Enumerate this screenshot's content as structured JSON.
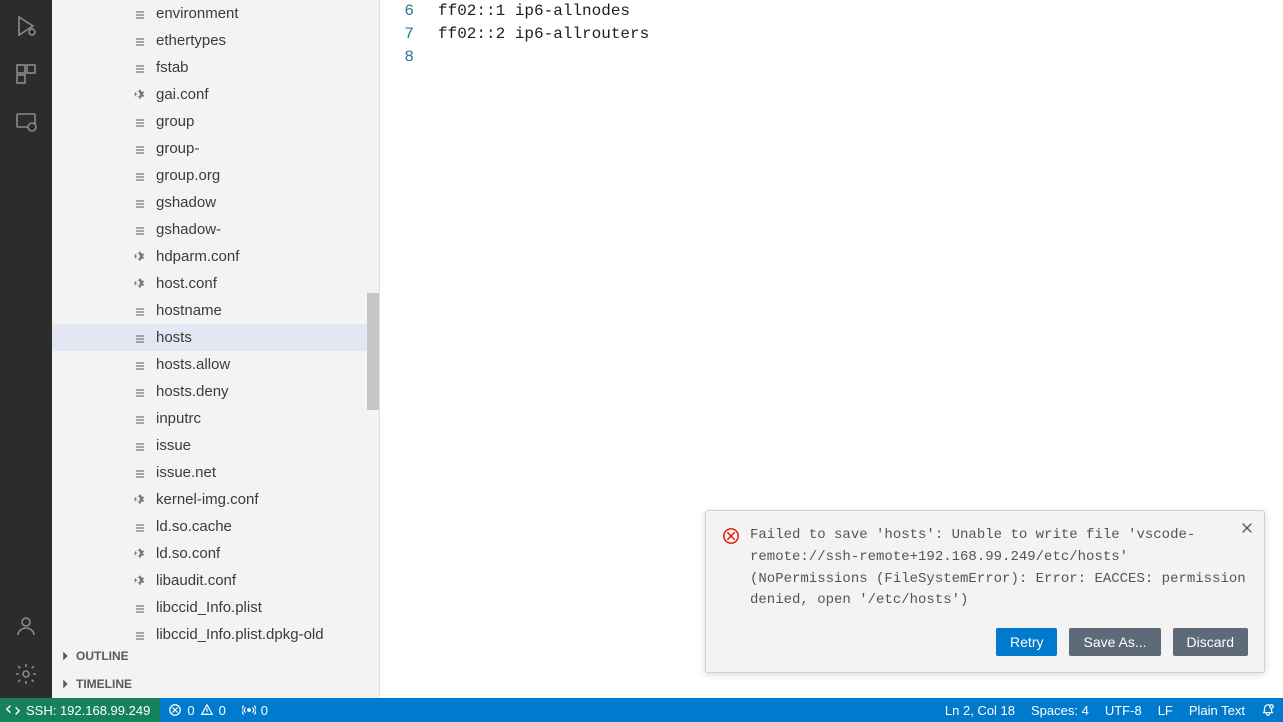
{
  "sidebar": {
    "files": [
      {
        "name": "environment",
        "icon": "file"
      },
      {
        "name": "ethertypes",
        "icon": "file"
      },
      {
        "name": "fstab",
        "icon": "file"
      },
      {
        "name": "gai.conf",
        "icon": "gear"
      },
      {
        "name": "group",
        "icon": "file"
      },
      {
        "name": "group-",
        "icon": "file"
      },
      {
        "name": "group.org",
        "icon": "file"
      },
      {
        "name": "gshadow",
        "icon": "file"
      },
      {
        "name": "gshadow-",
        "icon": "file"
      },
      {
        "name": "hdparm.conf",
        "icon": "gear"
      },
      {
        "name": "host.conf",
        "icon": "gear"
      },
      {
        "name": "hostname",
        "icon": "file"
      },
      {
        "name": "hosts",
        "icon": "file",
        "selected": true
      },
      {
        "name": "hosts.allow",
        "icon": "file"
      },
      {
        "name": "hosts.deny",
        "icon": "file"
      },
      {
        "name": "inputrc",
        "icon": "file"
      },
      {
        "name": "issue",
        "icon": "file"
      },
      {
        "name": "issue.net",
        "icon": "file"
      },
      {
        "name": "kernel-img.conf",
        "icon": "gear"
      },
      {
        "name": "ld.so.cache",
        "icon": "file"
      },
      {
        "name": "ld.so.conf",
        "icon": "gear"
      },
      {
        "name": "libaudit.conf",
        "icon": "gear"
      },
      {
        "name": "libccid_Info.plist",
        "icon": "file"
      },
      {
        "name": "libccid_Info.plist.dpkg-old",
        "icon": "file"
      }
    ],
    "panels": {
      "outline": "OUTLINE",
      "timeline": "TIMELINE"
    }
  },
  "editor": {
    "lines": [
      {
        "num": "6",
        "text": "ff02::1 ip6-allnodes"
      },
      {
        "num": "7",
        "text": "ff02::2 ip6-allrouters"
      },
      {
        "num": "8",
        "text": ""
      }
    ]
  },
  "toast": {
    "message": "Failed to save 'hosts': Unable to write file 'vscode-remote://ssh-remote+192.168.99.249/etc/hosts' (NoPermissions (FileSystemError): Error: EACCES: permission denied, open '/etc/hosts')",
    "actions": {
      "retry": "Retry",
      "saveas": "Save As...",
      "discard": "Discard"
    }
  },
  "status": {
    "remote": "SSH: 192.168.99.249",
    "errors": "0",
    "warnings": "0",
    "ports": "0",
    "ln": "Ln 2, Col 18",
    "spaces": "Spaces: 4",
    "encoding": "UTF-8",
    "eol": "LF",
    "lang": "Plain Text"
  }
}
